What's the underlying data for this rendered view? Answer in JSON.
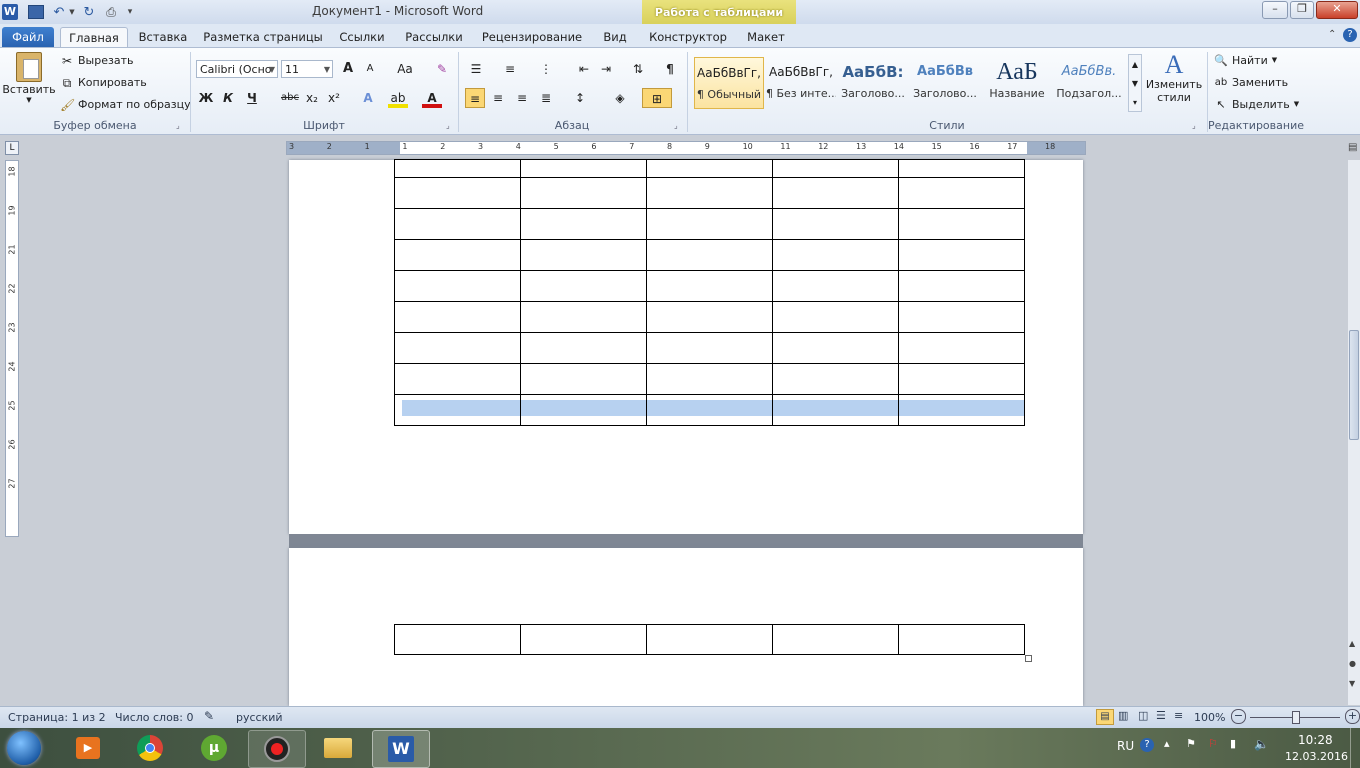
{
  "window": {
    "title": "Документ1  -  Microsoft Word",
    "context_tab_group": "Работа с таблицами"
  },
  "tabs": [
    "Файл",
    "Главная",
    "Вставка",
    "Разметка страницы",
    "Ссылки",
    "Рассылки",
    "Рецензирование",
    "Вид",
    "Конструктор",
    "Макет"
  ],
  "clipboard": {
    "paste": "Вставить",
    "cut": "Вырезать",
    "copy": "Копировать",
    "format_painter": "Формат по образцу",
    "label": "Буфер обмена"
  },
  "font": {
    "name": "Calibri (Осно",
    "size": "11",
    "grow": "A",
    "shrink": "A",
    "case": "Аа",
    "bold": "Ж",
    "italic": "К",
    "underline": "Ч",
    "strike": "abc",
    "subscript": "x₂",
    "superscript": "x²",
    "label": "Шрифт"
  },
  "paragraph": {
    "label": "Абзац",
    "pilcrow": "¶"
  },
  "styles": {
    "label": "Стили",
    "items": [
      {
        "sample": "АаБбВвГг,",
        "name": "¶ Обычный"
      },
      {
        "sample": "АаБбВвГг,",
        "name": "¶ Без инте..."
      },
      {
        "sample": "АаБбВ:",
        "name": "Заголово..."
      },
      {
        "sample": "АаБбВв",
        "name": "Заголово..."
      },
      {
        "sample": "АаБ",
        "name": "Название"
      },
      {
        "sample": "АаБбВв.",
        "name": "Подзагол..."
      }
    ],
    "change_styles_1": "Изменить",
    "change_styles_2": "стили"
  },
  "editing": {
    "label": "Редактирование",
    "find": "Найти",
    "replace": "Заменить",
    "select": "Выделить"
  },
  "ruler": {
    "h_ticks": [
      "3",
      "2",
      "1",
      "1",
      "2",
      "3",
      "4",
      "5",
      "6",
      "7",
      "8",
      "9",
      "10",
      "11",
      "12",
      "13",
      "14",
      "15",
      "16",
      "17",
      "18"
    ],
    "v_ticks": [
      "18",
      "19",
      "21",
      "22",
      "23",
      "24",
      "25",
      "26",
      "27"
    ]
  },
  "table": {
    "columns": 5,
    "top_rows": 9,
    "bottom_rows": 1
  },
  "status": {
    "page": "Страница: 1 из 2",
    "words": "Число слов: 0",
    "language": "русский",
    "zoom": "100%"
  },
  "taskbar": {
    "lang": "RU",
    "time": "10:28",
    "date": "12.03.2016"
  },
  "colors": {
    "file_tab": "#2a63b1",
    "selection": "#b7d1f0",
    "context_tab": "#d7cf58",
    "font_color": "#d01010",
    "highlight": "#f0e000"
  }
}
